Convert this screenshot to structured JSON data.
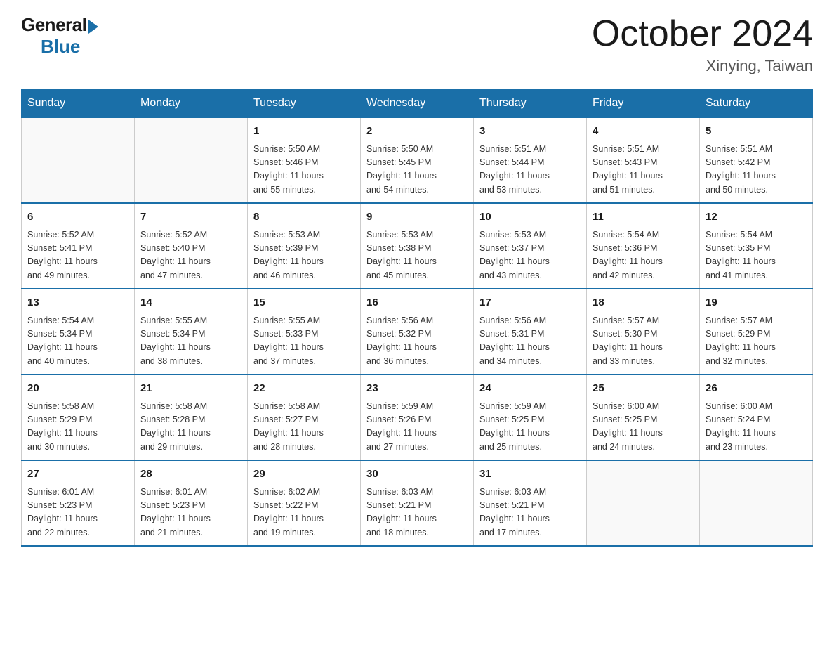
{
  "header": {
    "logo_general": "General",
    "logo_blue": "Blue",
    "month_title": "October 2024",
    "location": "Xinying, Taiwan"
  },
  "weekdays": [
    "Sunday",
    "Monday",
    "Tuesday",
    "Wednesday",
    "Thursday",
    "Friday",
    "Saturday"
  ],
  "weeks": [
    [
      {
        "day": "",
        "info": ""
      },
      {
        "day": "",
        "info": ""
      },
      {
        "day": "1",
        "info": "Sunrise: 5:50 AM\nSunset: 5:46 PM\nDaylight: 11 hours\nand 55 minutes."
      },
      {
        "day": "2",
        "info": "Sunrise: 5:50 AM\nSunset: 5:45 PM\nDaylight: 11 hours\nand 54 minutes."
      },
      {
        "day": "3",
        "info": "Sunrise: 5:51 AM\nSunset: 5:44 PM\nDaylight: 11 hours\nand 53 minutes."
      },
      {
        "day": "4",
        "info": "Sunrise: 5:51 AM\nSunset: 5:43 PM\nDaylight: 11 hours\nand 51 minutes."
      },
      {
        "day": "5",
        "info": "Sunrise: 5:51 AM\nSunset: 5:42 PM\nDaylight: 11 hours\nand 50 minutes."
      }
    ],
    [
      {
        "day": "6",
        "info": "Sunrise: 5:52 AM\nSunset: 5:41 PM\nDaylight: 11 hours\nand 49 minutes."
      },
      {
        "day": "7",
        "info": "Sunrise: 5:52 AM\nSunset: 5:40 PM\nDaylight: 11 hours\nand 47 minutes."
      },
      {
        "day": "8",
        "info": "Sunrise: 5:53 AM\nSunset: 5:39 PM\nDaylight: 11 hours\nand 46 minutes."
      },
      {
        "day": "9",
        "info": "Sunrise: 5:53 AM\nSunset: 5:38 PM\nDaylight: 11 hours\nand 45 minutes."
      },
      {
        "day": "10",
        "info": "Sunrise: 5:53 AM\nSunset: 5:37 PM\nDaylight: 11 hours\nand 43 minutes."
      },
      {
        "day": "11",
        "info": "Sunrise: 5:54 AM\nSunset: 5:36 PM\nDaylight: 11 hours\nand 42 minutes."
      },
      {
        "day": "12",
        "info": "Sunrise: 5:54 AM\nSunset: 5:35 PM\nDaylight: 11 hours\nand 41 minutes."
      }
    ],
    [
      {
        "day": "13",
        "info": "Sunrise: 5:54 AM\nSunset: 5:34 PM\nDaylight: 11 hours\nand 40 minutes."
      },
      {
        "day": "14",
        "info": "Sunrise: 5:55 AM\nSunset: 5:34 PM\nDaylight: 11 hours\nand 38 minutes."
      },
      {
        "day": "15",
        "info": "Sunrise: 5:55 AM\nSunset: 5:33 PM\nDaylight: 11 hours\nand 37 minutes."
      },
      {
        "day": "16",
        "info": "Sunrise: 5:56 AM\nSunset: 5:32 PM\nDaylight: 11 hours\nand 36 minutes."
      },
      {
        "day": "17",
        "info": "Sunrise: 5:56 AM\nSunset: 5:31 PM\nDaylight: 11 hours\nand 34 minutes."
      },
      {
        "day": "18",
        "info": "Sunrise: 5:57 AM\nSunset: 5:30 PM\nDaylight: 11 hours\nand 33 minutes."
      },
      {
        "day": "19",
        "info": "Sunrise: 5:57 AM\nSunset: 5:29 PM\nDaylight: 11 hours\nand 32 minutes."
      }
    ],
    [
      {
        "day": "20",
        "info": "Sunrise: 5:58 AM\nSunset: 5:29 PM\nDaylight: 11 hours\nand 30 minutes."
      },
      {
        "day": "21",
        "info": "Sunrise: 5:58 AM\nSunset: 5:28 PM\nDaylight: 11 hours\nand 29 minutes."
      },
      {
        "day": "22",
        "info": "Sunrise: 5:58 AM\nSunset: 5:27 PM\nDaylight: 11 hours\nand 28 minutes."
      },
      {
        "day": "23",
        "info": "Sunrise: 5:59 AM\nSunset: 5:26 PM\nDaylight: 11 hours\nand 27 minutes."
      },
      {
        "day": "24",
        "info": "Sunrise: 5:59 AM\nSunset: 5:25 PM\nDaylight: 11 hours\nand 25 minutes."
      },
      {
        "day": "25",
        "info": "Sunrise: 6:00 AM\nSunset: 5:25 PM\nDaylight: 11 hours\nand 24 minutes."
      },
      {
        "day": "26",
        "info": "Sunrise: 6:00 AM\nSunset: 5:24 PM\nDaylight: 11 hours\nand 23 minutes."
      }
    ],
    [
      {
        "day": "27",
        "info": "Sunrise: 6:01 AM\nSunset: 5:23 PM\nDaylight: 11 hours\nand 22 minutes."
      },
      {
        "day": "28",
        "info": "Sunrise: 6:01 AM\nSunset: 5:23 PM\nDaylight: 11 hours\nand 21 minutes."
      },
      {
        "day": "29",
        "info": "Sunrise: 6:02 AM\nSunset: 5:22 PM\nDaylight: 11 hours\nand 19 minutes."
      },
      {
        "day": "30",
        "info": "Sunrise: 6:03 AM\nSunset: 5:21 PM\nDaylight: 11 hours\nand 18 minutes."
      },
      {
        "day": "31",
        "info": "Sunrise: 6:03 AM\nSunset: 5:21 PM\nDaylight: 11 hours\nand 17 minutes."
      },
      {
        "day": "",
        "info": ""
      },
      {
        "day": "",
        "info": ""
      }
    ]
  ]
}
